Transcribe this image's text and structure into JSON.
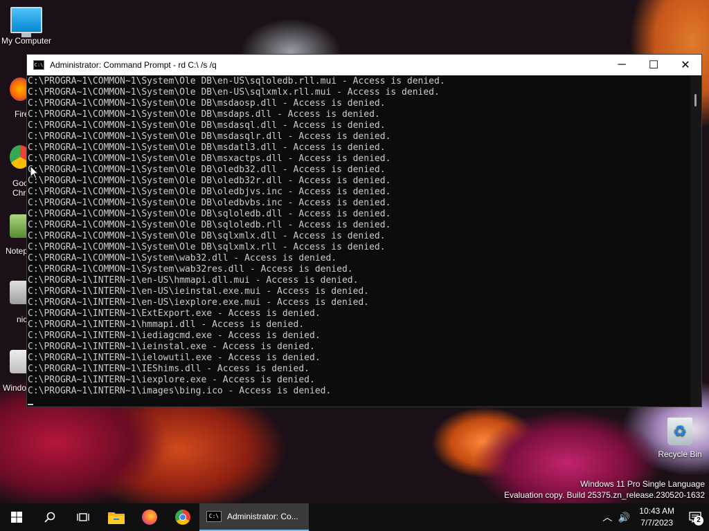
{
  "desktop": {
    "icons": [
      {
        "label": "My Computer"
      },
      {
        "label": "Fire"
      },
      {
        "label": "Goo Chro"
      },
      {
        "label": "Notep"
      },
      {
        "label": "nic"
      },
      {
        "label": "Windo"
      },
      {
        "label": "Recycle Bin"
      }
    ],
    "watermark": {
      "line1": "Windows 11 Pro Single Language",
      "line2": "Evaluation copy. Build 25375.zn_release.230520-1632"
    }
  },
  "window": {
    "title": "Administrator:  Command Prompt - rd  C:\\ /s /q",
    "icon_text": "C:\\",
    "buttons": {
      "minimize": "─",
      "maximize": "☐",
      "close": "✕"
    },
    "lines": [
      "C:\\PROGRA~1\\COMMON~1\\System\\Ole DB\\en-US\\sqloledb.rll.mui - Access is denied.",
      "C:\\PROGRA~1\\COMMON~1\\System\\Ole DB\\en-US\\sqlxmlx.rll.mui - Access is denied.",
      "C:\\PROGRA~1\\COMMON~1\\System\\Ole DB\\msdaosp.dll - Access is denied.",
      "C:\\PROGRA~1\\COMMON~1\\System\\Ole DB\\msdaps.dll - Access is denied.",
      "C:\\PROGRA~1\\COMMON~1\\System\\Ole DB\\msdasql.dll - Access is denied.",
      "C:\\PROGRA~1\\COMMON~1\\System\\Ole DB\\msdasqlr.dll - Access is denied.",
      "C:\\PROGRA~1\\COMMON~1\\System\\Ole DB\\msdatl3.dll - Access is denied.",
      "C:\\PROGRA~1\\COMMON~1\\System\\Ole DB\\msxactps.dll - Access is denied.",
      "C:\\PROGRA~1\\COMMON~1\\System\\Ole DB\\oledb32.dll - Access is denied.",
      "C:\\PROGRA~1\\COMMON~1\\System\\Ole DB\\oledb32r.dll - Access is denied.",
      "C:\\PROGRA~1\\COMMON~1\\System\\Ole DB\\oledbjvs.inc - Access is denied.",
      "C:\\PROGRA~1\\COMMON~1\\System\\Ole DB\\oledbvbs.inc - Access is denied.",
      "C:\\PROGRA~1\\COMMON~1\\System\\Ole DB\\sqloledb.dll - Access is denied.",
      "C:\\PROGRA~1\\COMMON~1\\System\\Ole DB\\sqloledb.rll - Access is denied.",
      "C:\\PROGRA~1\\COMMON~1\\System\\Ole DB\\sqlxmlx.dll - Access is denied.",
      "C:\\PROGRA~1\\COMMON~1\\System\\Ole DB\\sqlxmlx.rll - Access is denied.",
      "C:\\PROGRA~1\\COMMON~1\\System\\wab32.dll - Access is denied.",
      "C:\\PROGRA~1\\COMMON~1\\System\\wab32res.dll - Access is denied.",
      "C:\\PROGRA~1\\INTERN~1\\en-US\\hmmapi.dll.mui - Access is denied.",
      "C:\\PROGRA~1\\INTERN~1\\en-US\\ieinstal.exe.mui - Access is denied.",
      "C:\\PROGRA~1\\INTERN~1\\en-US\\iexplore.exe.mui - Access is denied.",
      "C:\\PROGRA~1\\INTERN~1\\ExtExport.exe - Access is denied.",
      "C:\\PROGRA~1\\INTERN~1\\hmmapi.dll - Access is denied.",
      "C:\\PROGRA~1\\INTERN~1\\iediagcmd.exe - Access is denied.",
      "C:\\PROGRA~1\\INTERN~1\\ieinstal.exe - Access is denied.",
      "C:\\PROGRA~1\\INTERN~1\\ielowutil.exe - Access is denied.",
      "C:\\PROGRA~1\\INTERN~1\\IEShims.dll - Access is denied.",
      "C:\\PROGRA~1\\INTERN~1\\iexplore.exe - Access is denied.",
      "C:\\PROGRA~1\\INTERN~1\\images\\bing.ico - Access is denied."
    ]
  },
  "taskbar": {
    "active_task_label": "Administrator:  Co...",
    "task_icon_text": "C:\\",
    "time": "10:43 AM",
    "date": "7/7/2023",
    "notification_count": "2",
    "icons": [
      "windows-start-icon",
      "search-icon",
      "task-view-icon",
      "file-explorer-icon",
      "firefox-icon",
      "chrome-icon"
    ]
  },
  "colors": {
    "accent": "#76b9ed",
    "console_bg": "#0c0c0c",
    "console_text": "#cccccc"
  }
}
